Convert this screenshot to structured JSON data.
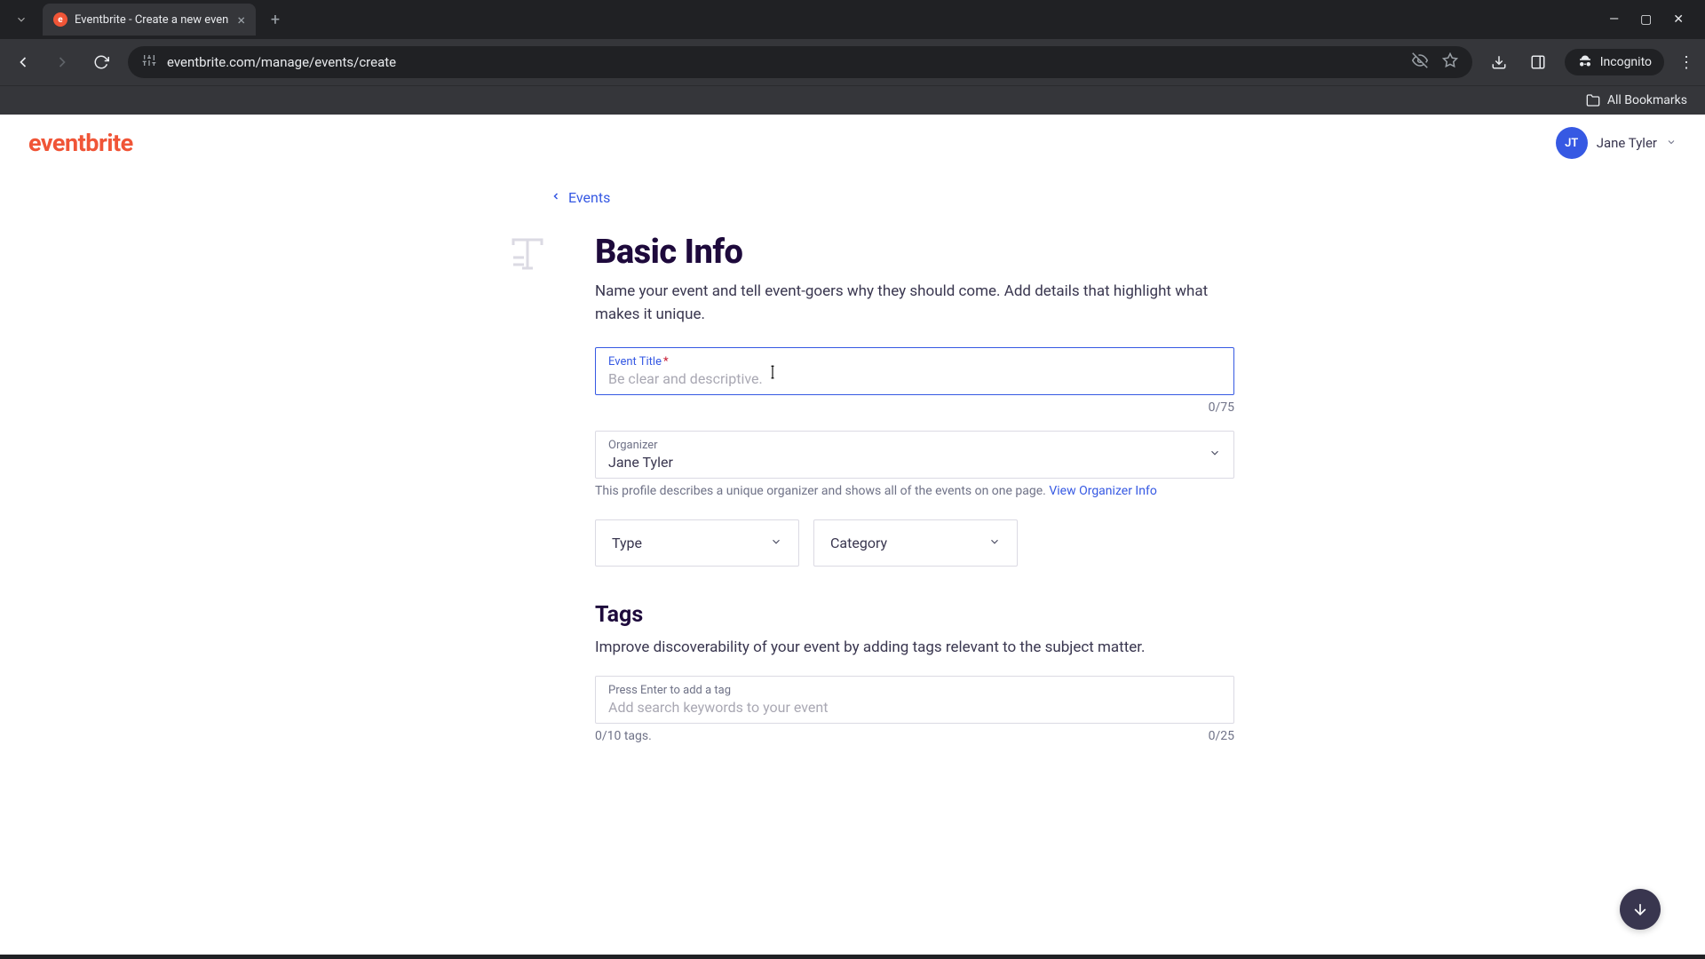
{
  "browser": {
    "tab_title": "Eventbrite - Create a new even",
    "url": "eventbrite.com/manage/events/create",
    "incognito_label": "Incognito",
    "all_bookmarks": "All Bookmarks"
  },
  "header": {
    "logo": "eventbrite",
    "user_initials": "JT",
    "user_name": "Jane Tyler"
  },
  "breadcrumb": {
    "label": "Events"
  },
  "basic_info": {
    "title": "Basic Info",
    "description": "Name your event and tell event-goers why they should come. Add details that highlight what makes it unique.",
    "event_title": {
      "label": "Event Title",
      "placeholder": "Be clear and descriptive.",
      "value": "",
      "counter": "0/75"
    },
    "organizer": {
      "label": "Organizer",
      "value": "Jane Tyler",
      "helper": "This profile describes a unique organizer and shows all of the events on one page. ",
      "helper_link": "View Organizer Info"
    },
    "type_label": "Type",
    "category_label": "Category"
  },
  "tags": {
    "title": "Tags",
    "description": "Improve discoverability of your event by adding tags relevant to the subject matter.",
    "label": "Press Enter to add a tag",
    "placeholder": "Add search keywords to your event",
    "count": "0/10 tags.",
    "char_counter": "0/25"
  }
}
